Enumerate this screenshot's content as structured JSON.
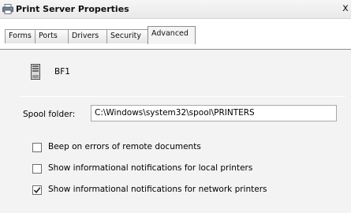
{
  "window": {
    "title": "Print Server Properties",
    "close_label": "x"
  },
  "tabs": [
    {
      "label": "Forms",
      "active": false
    },
    {
      "label": "Ports",
      "active": false
    },
    {
      "label": "Drivers",
      "active": false
    },
    {
      "label": "Security",
      "active": false
    },
    {
      "label": "Advanced",
      "active": true
    }
  ],
  "server": {
    "icon": "server-icon",
    "name": "BF1"
  },
  "spool": {
    "label": "Spool folder:",
    "value": "C:\\Windows\\system32\\spool\\PRINTERS"
  },
  "options": [
    {
      "label": "Beep on errors of remote documents",
      "checked": false
    },
    {
      "label": "Show informational notifications for local printers",
      "checked": false
    },
    {
      "label": "Show informational notifications for network printers",
      "checked": true
    }
  ]
}
